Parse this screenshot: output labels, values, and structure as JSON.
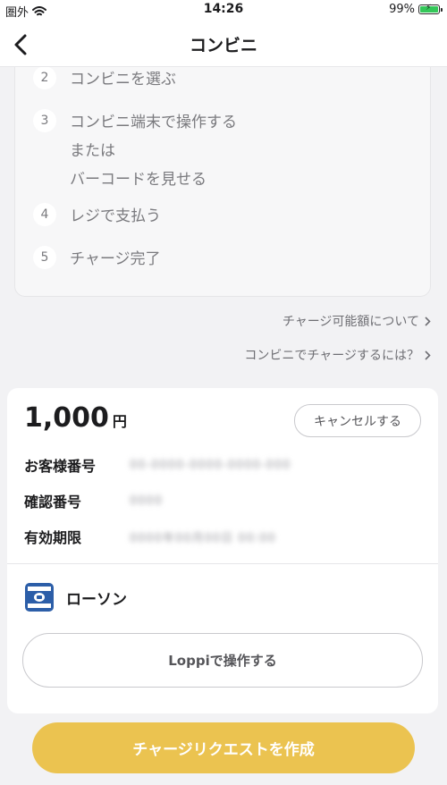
{
  "status_bar": {
    "carrier": "圏外",
    "time": "14:26",
    "battery": "99%"
  },
  "nav": {
    "title": "コンビニ"
  },
  "steps": [
    {
      "number": "2",
      "lines": [
        "コンビニを選ぶ"
      ]
    },
    {
      "number": "3",
      "lines": [
        "コンビニ端末で操作する",
        "または",
        "バーコードを見せる"
      ]
    },
    {
      "number": "4",
      "lines": [
        "レジで支払う"
      ]
    },
    {
      "number": "5",
      "lines": [
        "チャージ完了"
      ]
    }
  ],
  "links": {
    "charge_limit": "チャージ可能額について",
    "how_to_charge": "コンビニでチャージするには？"
  },
  "charge": {
    "amount": "1,000",
    "unit": "円",
    "cancel_label": "キャンセルする",
    "customer_number_label": "お客様番号",
    "customer_number_value": "00-0000-0000-0000-000",
    "confirmation_number_label": "確認番号",
    "confirmation_number_value": "0000",
    "expiry_label": "有効期限",
    "expiry_value": "0000年00月00日 00:00",
    "store_name": "ローソン",
    "loppi_label": "Loppiで操作する"
  },
  "create_button_label": "チャージリクエストを作成",
  "colors": {
    "accent": "#ebc350",
    "background": "#f2f2f4",
    "store_logo": "#2c5ea8"
  }
}
